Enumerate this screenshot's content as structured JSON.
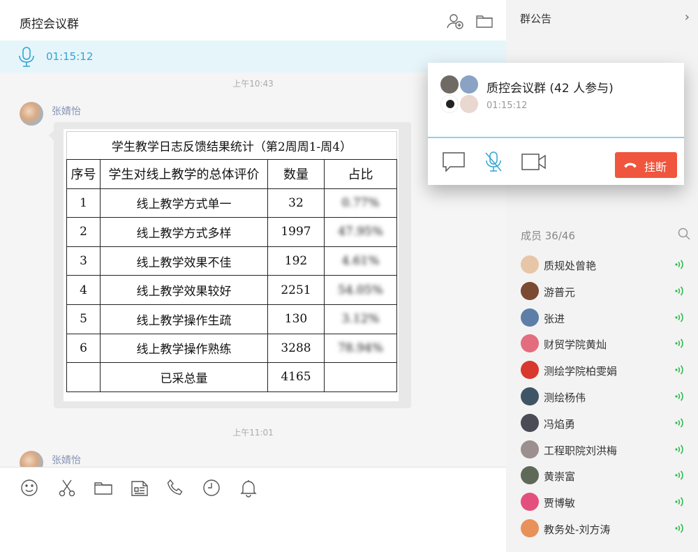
{
  "chat": {
    "title": "质控会议群",
    "call_timer": "01:15:12",
    "timestamps": [
      "上午10:43",
      "上午11:01"
    ],
    "messages": [
      {
        "sender": "张婧怡"
      },
      {
        "sender": "张婧怡"
      }
    ],
    "sheet": {
      "title": "学生教学日志反馈结果统计（第2周周1-周4）",
      "headers": [
        "序号",
        "学生对线上教学的总体评价",
        "数量",
        "占比"
      ],
      "rows": [
        [
          "1",
          "线上教学方式单一",
          "32",
          "0.77%"
        ],
        [
          "2",
          "线上教学方式多样",
          "1997",
          "47.95%"
        ],
        [
          "3",
          "线上教学效果不佳",
          "192",
          "4.61%"
        ],
        [
          "4",
          "线上教学效果较好",
          "2251",
          "54.05%"
        ],
        [
          "5",
          "线上教学操作生疏",
          "130",
          "3.12%"
        ],
        [
          "6",
          "线上教学操作熟练",
          "3288",
          "78.94%"
        ]
      ],
      "total_label": "已采总量",
      "total_value": "4165"
    }
  },
  "side": {
    "notice_label": "群公告",
    "members_title": "成员 36/46",
    "members": [
      {
        "name": "质规处曾艳",
        "color": "#e7c6a8"
      },
      {
        "name": "游普元",
        "color": "#7a4a32"
      },
      {
        "name": "张进",
        "color": "#5d7ea7"
      },
      {
        "name": "财贸学院黄灿",
        "color": "#e36d7e"
      },
      {
        "name": "测绘学院柏雯娟",
        "color": "#d8382e"
      },
      {
        "name": "测绘杨伟",
        "color": "#3f5566"
      },
      {
        "name": "冯焰勇",
        "color": "#4b4b55"
      },
      {
        "name": "工程职院刘洪梅",
        "color": "#9b8f8f"
      },
      {
        "name": "黄崇富",
        "color": "#5e6a57"
      },
      {
        "name": "贾博敏",
        "color": "#e4507d"
      },
      {
        "name": "教务处-刘方涛",
        "color": "#e8915a"
      }
    ],
    "speaker_color": "#2dbb4e"
  },
  "call": {
    "group_title": "质控会议群 (42 人参与)",
    "timer": "01:15:12",
    "hangup_label": "挂断",
    "accent": "#31a4d4",
    "hangup_color": "#f0553d"
  }
}
